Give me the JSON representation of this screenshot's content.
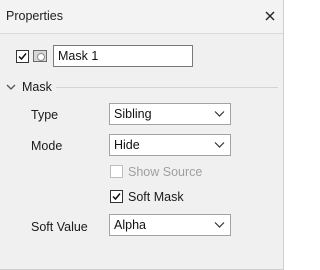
{
  "panel": {
    "title": "Properties"
  },
  "mask_row": {
    "enabled": true,
    "name_value": "Mask 1"
  },
  "mask_section": {
    "label": "Mask",
    "type": {
      "label": "Type",
      "value": "Sibling"
    },
    "mode": {
      "label": "Mode",
      "value": "Hide"
    },
    "show_source": {
      "label": "Show Source",
      "checked": false,
      "disabled": true
    },
    "soft_mask": {
      "label": "Soft Mask",
      "checked": true
    },
    "soft_value": {
      "label": "Soft Value",
      "value": "Alpha"
    }
  },
  "icons": [
    "close-icon",
    "checkmark-icon",
    "mask-thumbnail-icon",
    "collapse-chevron-icon",
    "dropdown-chevron-icon"
  ]
}
